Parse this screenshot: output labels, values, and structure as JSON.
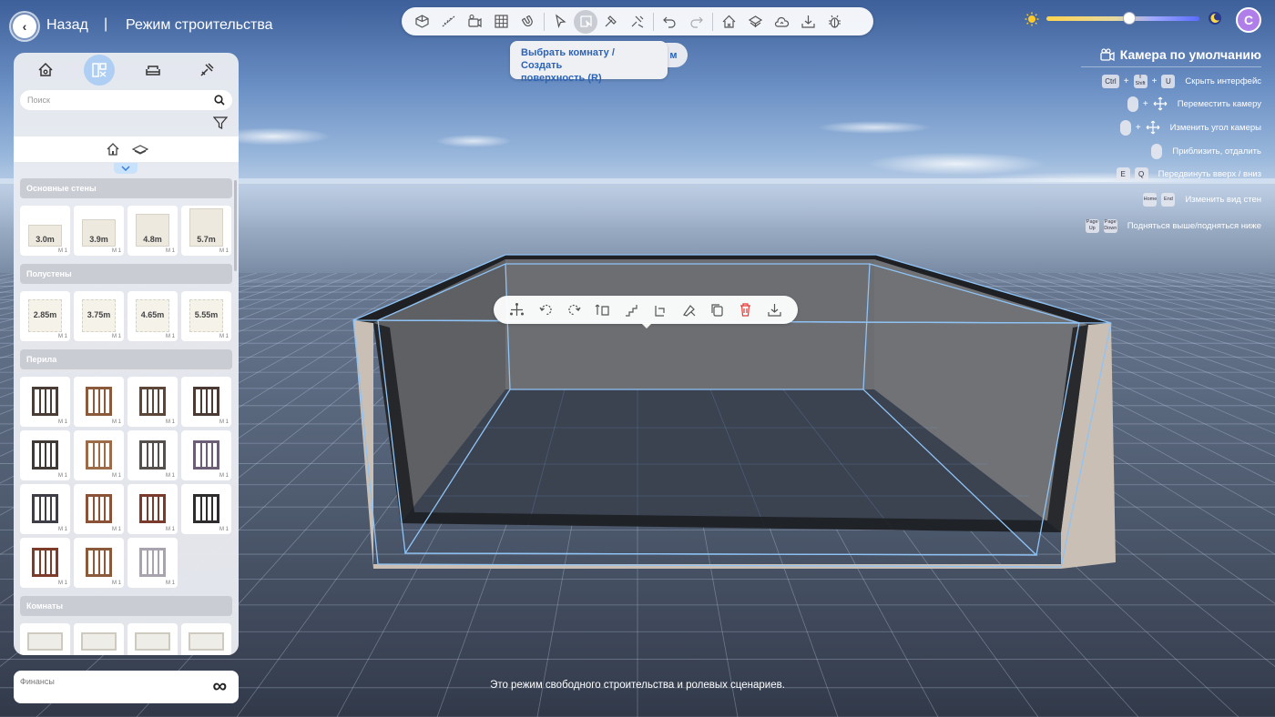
{
  "nav": {
    "back_label": "Назад",
    "separator": "|",
    "mode_title": "Режим строительства"
  },
  "toolbar": {
    "tools": [
      {
        "name": "view-3d-icon"
      },
      {
        "name": "measure-icon"
      },
      {
        "name": "camera-icon"
      },
      {
        "name": "grid-icon"
      },
      {
        "name": "magnet-icon"
      },
      {
        "name": "cursor-icon"
      },
      {
        "name": "select-room-icon",
        "active": true
      },
      {
        "name": "hammer-icon"
      },
      {
        "name": "repair-icon"
      },
      {
        "name": "undo-icon"
      },
      {
        "name": "redo-icon"
      },
      {
        "name": "house-tools-icon"
      },
      {
        "name": "layers-icon"
      },
      {
        "name": "cloud-house-icon"
      },
      {
        "name": "download-icon"
      },
      {
        "name": "bug-icon"
      }
    ],
    "tooltip_text_line1": "Выбрать комнату / Создать",
    "tooltip_text_line2": "поверхность (R)",
    "tooltip_tab_text": "м"
  },
  "time_of_day": {
    "value": 0.54,
    "sun_icon": "sun-icon",
    "moon_icon": "moon-icon"
  },
  "user": {
    "avatar_letter": "C"
  },
  "camera": {
    "title": "Камера по умолчанию",
    "hints": [
      {
        "keys": [
          "Ctrl",
          "+",
          "⇧ Shift",
          "+",
          "U"
        ],
        "label": "Скрыть интерфейс"
      },
      {
        "keys": [
          "mouse-left",
          "+",
          "move"
        ],
        "label": "Переместить камеру"
      },
      {
        "keys": [
          "mouse-right",
          "+",
          "move"
        ],
        "label": "Изменить угол камеры"
      },
      {
        "keys": [
          "mouse-wheel"
        ],
        "label": "Приблизить, отдалить"
      },
      {
        "keys": [
          "E",
          "Q"
        ],
        "label": "Передвинуть вверх / вниз"
      },
      {
        "keys": [
          "Home",
          "End"
        ],
        "label": "Изменить вид стен"
      },
      {
        "keys": [
          "Page Up",
          "Page Down"
        ],
        "label": "Подняться выше/подняться ниже"
      }
    ]
  },
  "panel": {
    "search_placeholder": "Поиск",
    "sections": [
      {
        "title": "Основные стены",
        "items": [
          {
            "dim": "3.0m",
            "badge": "M 1"
          },
          {
            "dim": "3.9m",
            "badge": "M 1"
          },
          {
            "dim": "4.8m",
            "badge": "M 1"
          },
          {
            "dim": "5.7m",
            "badge": "M 1"
          }
        ]
      },
      {
        "title": "Полустены",
        "items": [
          {
            "dim": "2.85m",
            "badge": "M 1"
          },
          {
            "dim": "3.75m",
            "badge": "M 1"
          },
          {
            "dim": "4.65m",
            "badge": "M 1"
          },
          {
            "dim": "5.55m",
            "badge": "M 1"
          }
        ]
      },
      {
        "title": "Перила",
        "items": [
          {
            "badge": "M 1"
          },
          {
            "badge": "M 1"
          },
          {
            "badge": "M 1"
          },
          {
            "badge": "M 1"
          },
          {
            "badge": "M 1"
          },
          {
            "badge": "M 1"
          },
          {
            "badge": "M 1"
          },
          {
            "badge": "M 1"
          },
          {
            "badge": "M 1"
          },
          {
            "badge": "M 1"
          },
          {
            "badge": "M 1"
          },
          {
            "badge": "M 1"
          },
          {
            "badge": "M 1"
          },
          {
            "badge": "M 1"
          },
          {
            "badge": "M 1"
          }
        ]
      },
      {
        "title": "Комнаты",
        "items": [
          {},
          {},
          {},
          {}
        ]
      }
    ]
  },
  "finance": {
    "label": "Финансы",
    "value": "∞"
  },
  "status": {
    "text": "Это режим свободного строительства и ролевых сценариев."
  }
}
